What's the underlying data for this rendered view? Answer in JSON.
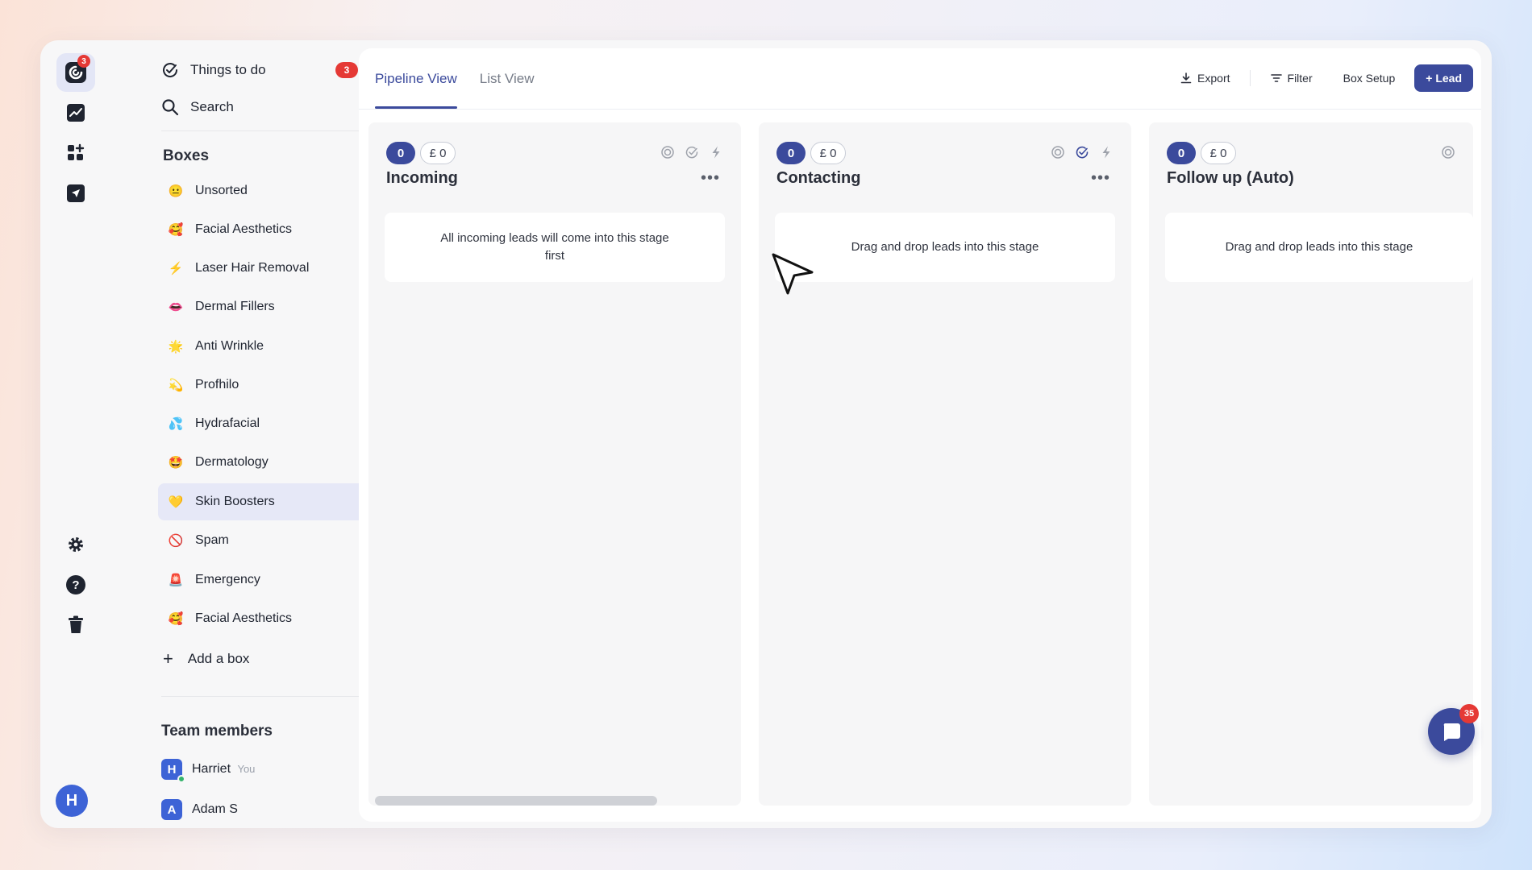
{
  "rail": {
    "logo_badge": "3",
    "profile_initial": "H"
  },
  "sidebar": {
    "things_to_do": {
      "label": "Things to do",
      "badge": "3"
    },
    "search_label": "Search",
    "boxes_title": "Boxes",
    "boxes": [
      {
        "label": "Unsorted",
        "emoji": "😐"
      },
      {
        "label": "Facial Aesthetics",
        "emoji": "🥰"
      },
      {
        "label": "Laser Hair Removal",
        "emoji": "⚡"
      },
      {
        "label": "Dermal Fillers",
        "emoji": "👄"
      },
      {
        "label": "Anti Wrinkle",
        "emoji": "🌟"
      },
      {
        "label": "Profhilo",
        "emoji": "💫"
      },
      {
        "label": "Hydrafacial",
        "emoji": "💦"
      },
      {
        "label": "Dermatology",
        "emoji": "🤩"
      },
      {
        "label": "Skin Boosters",
        "emoji": "💛"
      },
      {
        "label": "Spam",
        "emoji": "🚫"
      },
      {
        "label": "Emergency",
        "emoji": "🚨"
      },
      {
        "label": "Facial Aesthetics",
        "emoji": "🥰"
      }
    ],
    "add_box_label": "Add a box",
    "team_title": "Team members",
    "members": [
      {
        "initial": "H",
        "name": "Harriet",
        "tag": "You"
      },
      {
        "initial": "A",
        "name": "Adam S",
        "tag": ""
      }
    ]
  },
  "main": {
    "tabs": [
      {
        "label": "Pipeline View"
      },
      {
        "label": "List View"
      }
    ],
    "toolbar": {
      "export_label": "Export",
      "filter_label": "Filter",
      "box_setup_label": "Box Setup",
      "add_lead_label": "+ Lead"
    },
    "columns": [
      {
        "count": "0",
        "amount": "£ 0",
        "title": "Incoming",
        "message": "All incoming leads will come into this stage first"
      },
      {
        "count": "0",
        "amount": "£ 0",
        "title": "Contacting",
        "message": "Drag and drop leads into this stage"
      },
      {
        "count": "0",
        "amount": "£ 0",
        "title": "Follow up (Auto)",
        "message": "Drag and drop leads into this stage"
      }
    ]
  },
  "chat": {
    "badge": "35"
  },
  "colors": {
    "accent": "#3b4a9c",
    "badge": "#e53935",
    "avatar": "#3d63d6"
  }
}
